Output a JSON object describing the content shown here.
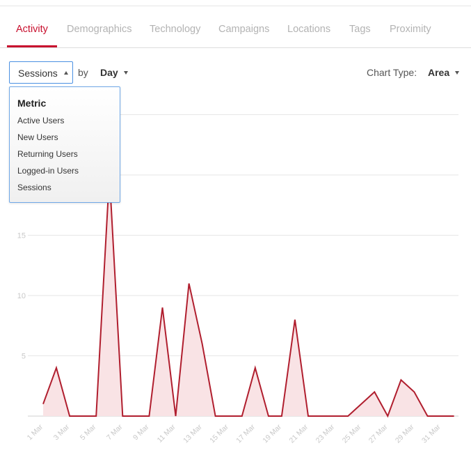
{
  "tabs": [
    {
      "label": "Activity",
      "active": true
    },
    {
      "label": "Demographics",
      "active": false
    },
    {
      "label": "Technology",
      "active": false
    },
    {
      "label": "Campaigns",
      "active": false
    },
    {
      "label": "Locations",
      "active": false
    },
    {
      "label": "Tags",
      "active": false
    },
    {
      "label": "Proximity",
      "active": false
    }
  ],
  "controls": {
    "metric_value": "Sessions",
    "by_label": "by",
    "interval_value": "Day",
    "chart_type_label": "Chart Type:",
    "chart_type_value": "Area"
  },
  "metric_dropdown": {
    "heading": "Metric",
    "options": [
      "Active Users",
      "New Users",
      "Returning Users",
      "Logged-in Users",
      "Sessions"
    ]
  },
  "colors": {
    "accent": "#c8102e",
    "line": "#b01e2e",
    "fill": "#f9e3e5",
    "grid": "#e6e6e6",
    "tick": "#c8c8c8",
    "focus_border": "#4a90e2"
  },
  "chart_data": {
    "type": "area",
    "title": "",
    "xlabel": "",
    "ylabel": "",
    "x": [
      "1 Mar",
      "2 Mar",
      "3 Mar",
      "4 Mar",
      "5 Mar",
      "6 Mar",
      "7 Mar",
      "8 Mar",
      "9 Mar",
      "10 Mar",
      "11 Mar",
      "12 Mar",
      "13 Mar",
      "14 Mar",
      "15 Mar",
      "16 Mar",
      "17 Mar",
      "18 Mar",
      "19 Mar",
      "20 Mar",
      "21 Mar",
      "22 Mar",
      "23 Mar",
      "24 Mar",
      "25 Mar",
      "26 Mar",
      "27 Mar",
      "28 Mar",
      "29 Mar",
      "30 Mar",
      "31 Mar",
      "1 Apr"
    ],
    "x_tick_labels": [
      "1 Mar",
      "3 Mar",
      "5 Mar",
      "7 Mar",
      "9 Mar",
      "11 Mar",
      "13 Mar",
      "15 Mar",
      "17 Mar",
      "19 Mar",
      "21 Mar",
      "23 Mar",
      "25 Mar",
      "27 Mar",
      "29 Mar",
      "31 Mar"
    ],
    "series": [
      {
        "values": [
          1,
          4,
          0,
          0,
          0,
          20,
          0,
          0,
          0,
          9,
          0,
          11,
          6,
          0,
          0,
          0,
          4,
          0,
          0,
          8,
          0,
          0,
          0,
          0,
          1,
          2,
          0,
          3,
          2,
          0,
          0,
          0
        ]
      }
    ],
    "y_ticks": [
      5,
      10,
      15
    ],
    "ylim": [
      0,
      25
    ],
    "grid": true,
    "legend": "none"
  }
}
